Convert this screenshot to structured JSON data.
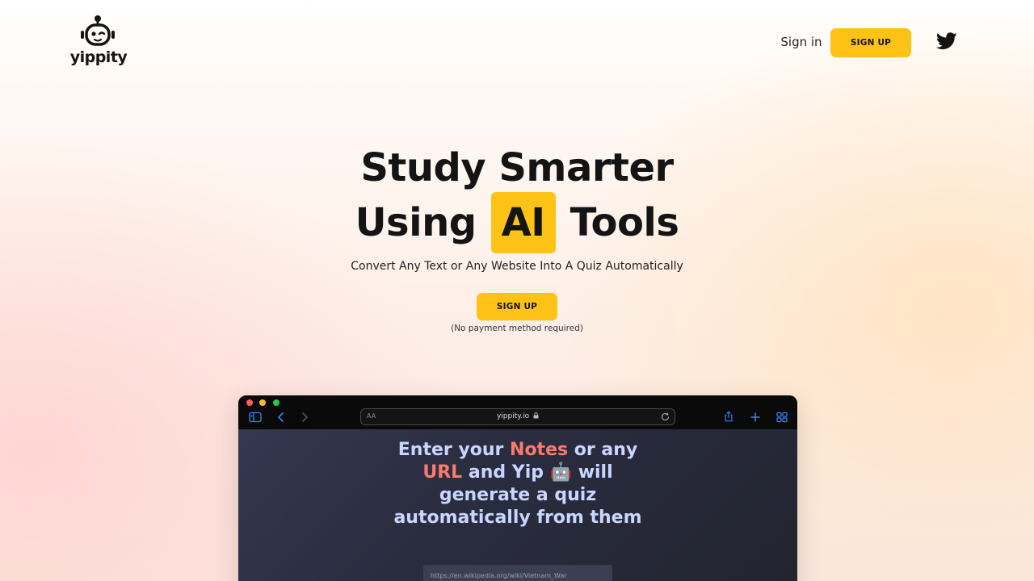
{
  "brand": {
    "name": "yippity"
  },
  "nav": {
    "signin_label": "Sign in",
    "signup_label": "SIGN UP"
  },
  "hero": {
    "title_line1": "Study Smarter",
    "title_line2_pre": "Using",
    "title_line2_highlight": "AI",
    "title_line2_post": "Tools",
    "subtitle": "Convert Any Text or Any Website Into A Quiz Automatically",
    "cta_label": "SIGN UP",
    "cta_note": "(No payment method required)"
  },
  "preview": {
    "address_aa": "AA",
    "address_url": "yippity.io",
    "heading_part1": "Enter your ",
    "heading_notes": "Notes",
    "heading_part2": " or any ",
    "heading_url": "URL",
    "heading_part3": " and Yip 🤖 will generate a quiz automatically from them",
    "url_input_value": "https://en.wikipedia.org/wiki/Vietnam_War"
  },
  "colors": {
    "accent_yellow": "#fec316",
    "highlight_coral": "#ff7a6e",
    "preview_text": "#c9d6ff"
  },
  "icons": [
    "robot-logo-icon",
    "twitter-icon",
    "sidebar-icon",
    "back-icon",
    "forward-icon",
    "lock-icon",
    "reload-icon",
    "share-icon",
    "new-tab-icon",
    "tabs-grid-icon"
  ]
}
